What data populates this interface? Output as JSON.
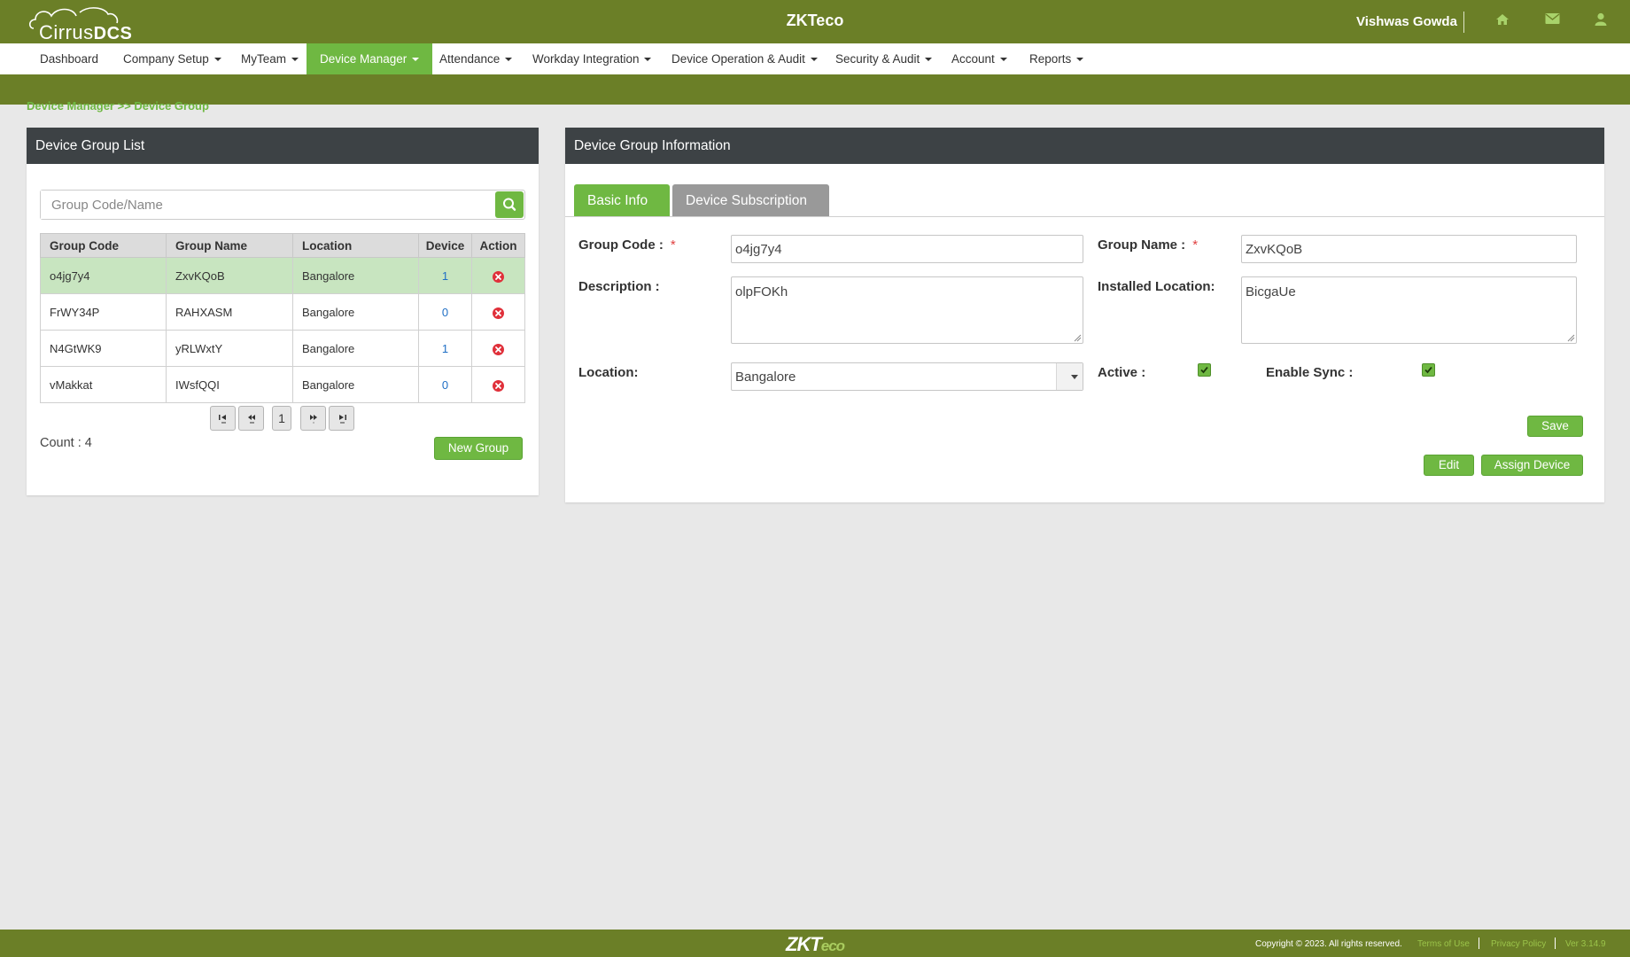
{
  "header": {
    "logo_light": "Cirrus",
    "logo_bold": "DCS",
    "brand": "ZKTeco",
    "user_name": "Vishwas Gowda",
    "icons": [
      "home-icon",
      "envelope-icon",
      "user-icon"
    ]
  },
  "nav": {
    "items": [
      {
        "label": "Dashboard"
      },
      {
        "label": "Company Setup"
      },
      {
        "label": "MyTeam"
      },
      {
        "label": "Device Manager"
      },
      {
        "label": "Attendance"
      },
      {
        "label": "Workday Integration"
      },
      {
        "label": "Device Operation & Audit"
      },
      {
        "label": "Security & Audit"
      },
      {
        "label": "Account"
      },
      {
        "label": "Reports"
      }
    ],
    "active": "Device Manager"
  },
  "breadcrumb": "Device Manager >> Device Group",
  "list_panel": {
    "title": "Device Group List",
    "search_placeholder": "Group Code/Name",
    "columns": [
      "Group Code",
      "Group Name",
      "Location",
      "Device",
      "Action"
    ],
    "rows": [
      {
        "code": "o4jg7y4",
        "name": "ZxvKQoB",
        "location": "Bangalore",
        "device": "1"
      },
      {
        "code": "FrWY34P",
        "name": "RAHXASM",
        "location": "Bangalore",
        "device": "0"
      },
      {
        "code": "N4GtWK9",
        "name": "yRLWxtY",
        "location": "Bangalore",
        "device": "1"
      },
      {
        "code": "vMakkat",
        "name": "IWsfQQI",
        "location": "Bangalore",
        "device": "0"
      }
    ],
    "selected_row": 0,
    "current_page": "1",
    "count_text": "Count : 4",
    "new_group_label": "New Group"
  },
  "info_panel": {
    "title": "Device Group Information",
    "tabs": [
      {
        "label": "Basic Info"
      },
      {
        "label": "Device Subscription"
      }
    ],
    "active_tab": "Basic Info",
    "fields": {
      "group_code_label": "Group Code :",
      "group_code_value": "o4jg7y4",
      "group_name_label": "Group Name :",
      "group_name_value": "ZxvKQoB",
      "description_label": "Description :",
      "description_value": "olpFOKh",
      "installed_location_label": "Installed Location:",
      "installed_location_value": "BicgaUe",
      "location_label": "Location:",
      "location_value": "Bangalore",
      "active_label": "Active :",
      "active_checked": true,
      "enable_sync_label": "Enable Sync :",
      "enable_sync_checked": true,
      "required_mark": "*"
    },
    "buttons": {
      "save": "Save",
      "edit": "Edit",
      "assign": "Assign Device"
    }
  },
  "footer": {
    "logo_main": "ZKT",
    "logo_suffix": "eco",
    "copyright": "Copyright © 2023. All rights reserved.",
    "terms": "Terms of Use",
    "privacy": "Privacy Policy",
    "version": "Ver 3.14.9"
  },
  "colors": {
    "brand_green": "#6b7f27",
    "accent_green": "#6fb842",
    "panel_header": "#3d4245",
    "selected_row": "#c8e5c0",
    "tab_inactive": "#999999",
    "delete_red": "#e0303a"
  }
}
